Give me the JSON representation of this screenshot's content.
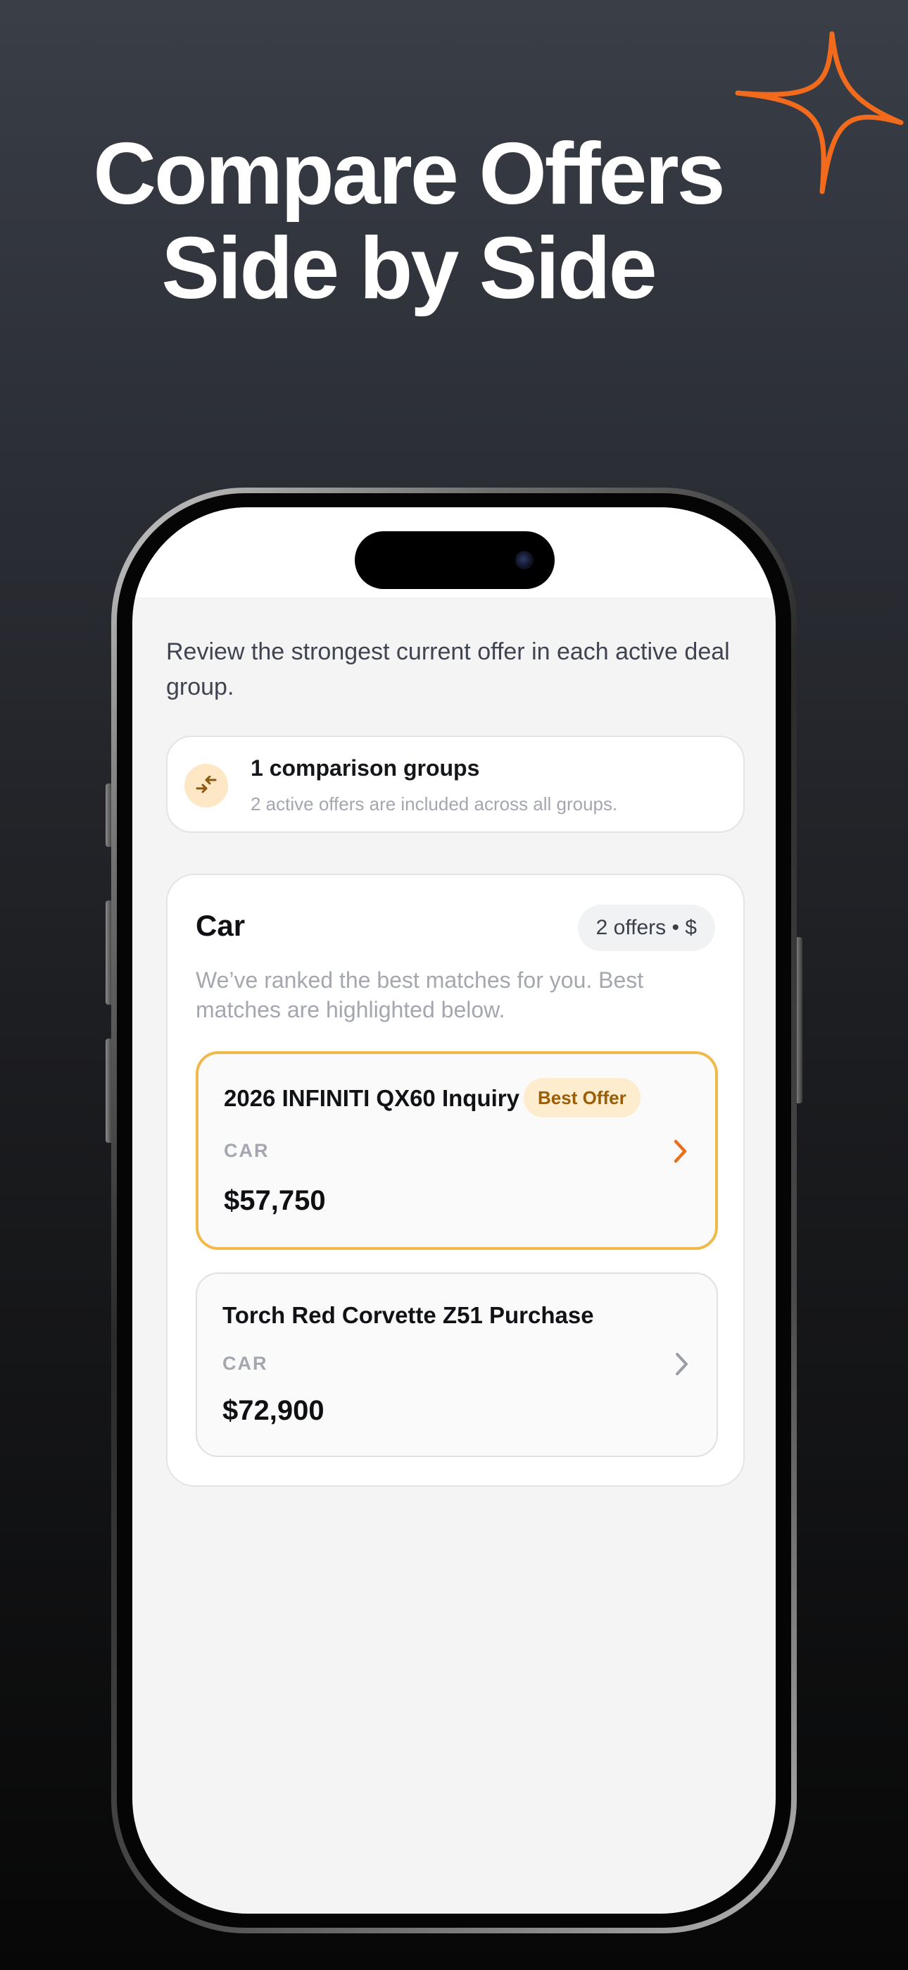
{
  "headline": {
    "line1": "Compare Offers",
    "line2": "Side by Side"
  },
  "accent_color": "#f26b1d",
  "intro_text": "Review the strongest current offer in each active deal group.",
  "summary": {
    "icon": "compare-arrows-icon",
    "title": "1 comparison groups",
    "subtitle": "2 active offers are included across all groups."
  },
  "group": {
    "title": "Car",
    "pill": "2 offers • $",
    "description": "We’ve ranked the best matches for you. Best matches are highlighted below.",
    "offers": [
      {
        "title": "2026 INFINITI QX60 Inquiry",
        "badge": "Best Offer",
        "category": "CAR",
        "price": "$57,750"
      },
      {
        "title": "Torch Red Corvette Z51 Purchase",
        "category": "CAR",
        "price": "$72,900"
      }
    ]
  }
}
